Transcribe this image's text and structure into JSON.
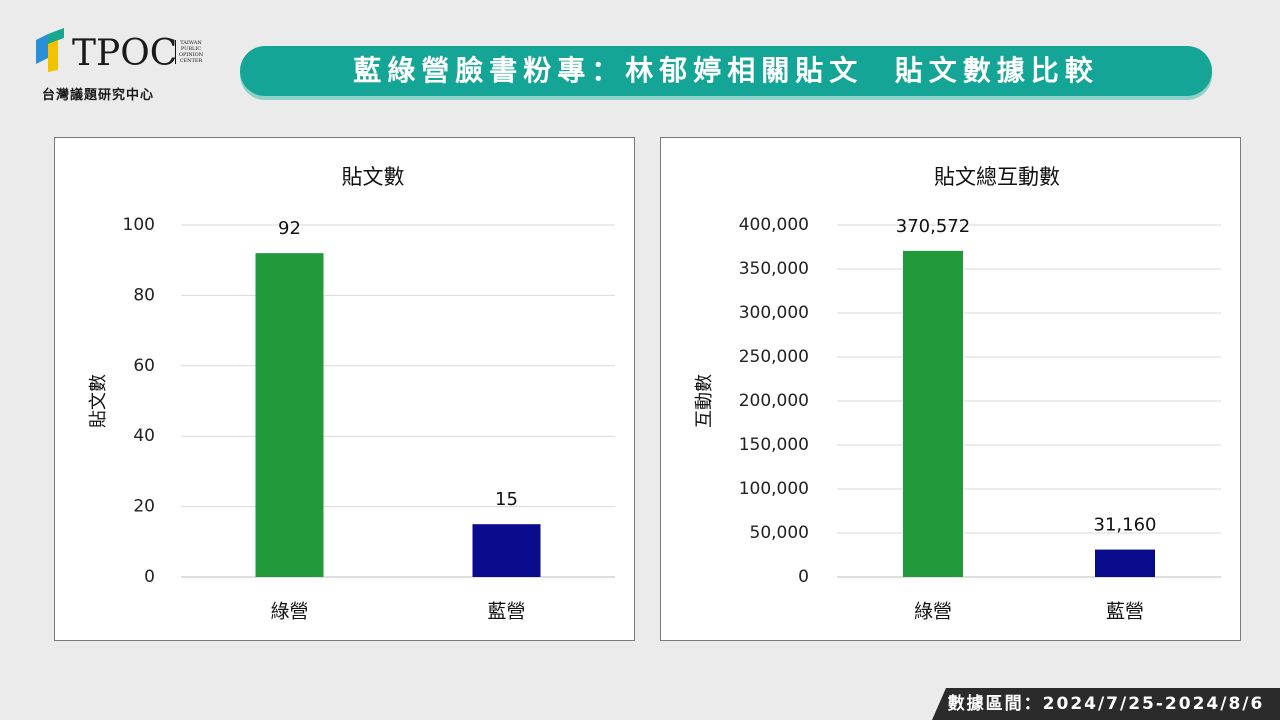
{
  "header": {
    "logo_text": "TPOC",
    "logo_small_lines": [
      "TAIWAN",
      "PUBLIC",
      "OPINION",
      "CENTER"
    ],
    "logo_subtitle": "台灣議題研究中心",
    "title": "藍綠營臉書粉專：林郁婷相關貼文  貼文數據比較"
  },
  "colors": {
    "green": "#22993a",
    "blue": "#0a0a8c",
    "title_bar": "#15a596"
  },
  "footer": {
    "date_range": "數據區間：2024/7/25-2024/8/6"
  },
  "chart_data": [
    {
      "type": "bar",
      "title": "貼文數",
      "ylabel": "貼文數",
      "xlabel": "",
      "categories": [
        "綠營",
        "藍營"
      ],
      "values": [
        92,
        15
      ],
      "value_labels": [
        "92",
        "15"
      ],
      "ylim": [
        0,
        100
      ],
      "yticks": [
        0,
        20,
        40,
        60,
        80,
        100
      ],
      "ytick_labels": [
        "0",
        "20",
        "40",
        "60",
        "80",
        "100"
      ],
      "bar_colors": [
        "#22993a",
        "#0a0a8c"
      ],
      "grid": true,
      "legend": "none"
    },
    {
      "type": "bar",
      "title": "貼文總互動數",
      "ylabel": "互動數",
      "xlabel": "",
      "categories": [
        "綠營",
        "藍營"
      ],
      "values": [
        370572,
        31160
      ],
      "value_labels": [
        "370,572",
        "31,160"
      ],
      "ylim": [
        0,
        400000
      ],
      "yticks": [
        0,
        50000,
        100000,
        150000,
        200000,
        250000,
        300000,
        350000,
        400000
      ],
      "ytick_labels": [
        "0",
        "50,000",
        "100,000",
        "150,000",
        "200,000",
        "250,000",
        "300,000",
        "350,000",
        "400,000"
      ],
      "bar_colors": [
        "#22993a",
        "#0a0a8c"
      ],
      "grid": true,
      "legend": "none"
    }
  ]
}
